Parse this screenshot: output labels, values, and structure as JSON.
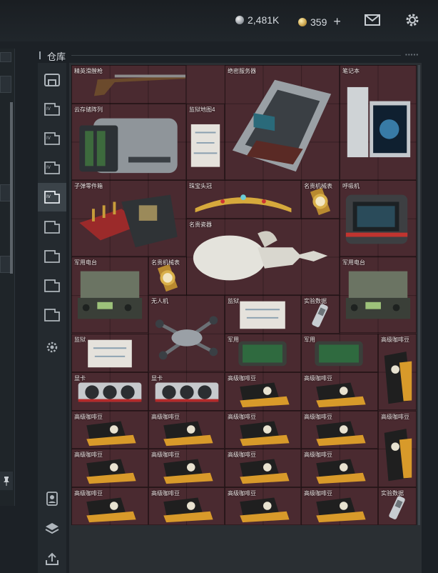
{
  "currency": {
    "silver": "2,481K",
    "gold": "359",
    "add_label": "+"
  },
  "top_icons": [
    "mail-icon",
    "gear-icon"
  ],
  "left_panel": {
    "pin_icon": "pin-icon"
  },
  "warehouse": {
    "title": "仓库"
  },
  "tabs": [
    {
      "icon": "home-icon",
      "active": false
    },
    {
      "icon": "storage-icon",
      "active": false
    },
    {
      "icon": "storage-icon",
      "active": false
    },
    {
      "icon": "storage-icon",
      "active": false
    },
    {
      "icon": "storage-icon",
      "active": true
    },
    {
      "icon": "storage-icon",
      "active": false
    },
    {
      "icon": "storage-icon",
      "active": false
    },
    {
      "icon": "storage-icon",
      "active": false
    },
    {
      "icon": "storage-icon",
      "active": false
    },
    {
      "icon": "gear-icon",
      "active": false
    },
    {
      "icon": "avatar-icon",
      "active": false
    },
    {
      "icon": "layers-icon",
      "active": false
    },
    {
      "icon": "upload-icon",
      "active": false
    }
  ],
  "items": [
    {
      "label": "精英滑膛枪",
      "icon": "musket-icon"
    },
    {
      "label": "绝密服务器",
      "icon": "server-icon"
    },
    {
      "label": "笔记本",
      "icon": "laptop-icon"
    },
    {
      "label": "云存储阵列",
      "icon": "storage-array-icon"
    },
    {
      "label": "监狱地图4",
      "icon": "map-icon"
    },
    {
      "label": "子弹零件箱",
      "icon": "ammo-crate-icon"
    },
    {
      "label": "珠宝头冠",
      "icon": "crown-icon"
    },
    {
      "label": "名贵机械表",
      "icon": "watch-icon"
    },
    {
      "label": "呼吸机",
      "icon": "ventilator-icon"
    },
    {
      "label": "名贵瓷器",
      "icon": "porcelain-icon"
    },
    {
      "label": "军用电台",
      "icon": "radio-icon"
    },
    {
      "label": "名贵机械表",
      "icon": "watch-icon"
    },
    {
      "label": "军用电台",
      "icon": "radio-icon"
    },
    {
      "label": "无人机",
      "icon": "drone-icon"
    },
    {
      "label": "监狱",
      "icon": "map-icon"
    },
    {
      "label": "实验数据",
      "icon": "data-icon"
    },
    {
      "label": "监狱",
      "icon": "map-icon"
    },
    {
      "label": "军用",
      "icon": "tablet-icon"
    },
    {
      "label": "军用",
      "icon": "tablet-icon"
    },
    {
      "label": "高级咖啡豆",
      "icon": "coffee-bag-icon"
    },
    {
      "label": "显卡",
      "icon": "gpu-icon"
    },
    {
      "label": "显卡",
      "icon": "gpu-icon"
    },
    {
      "label": "高级咖啡豆",
      "icon": "coffee-icon"
    },
    {
      "label": "高级咖啡豆",
      "icon": "coffee-icon"
    },
    {
      "label": "高级咖啡豆",
      "icon": "coffee-icon"
    },
    {
      "label": "高级咖啡豆",
      "icon": "coffee-icon"
    },
    {
      "label": "高级咖啡豆",
      "icon": "coffee-icon"
    },
    {
      "label": "高级咖啡豆",
      "icon": "coffee-icon"
    },
    {
      "label": "高级咖啡豆",
      "icon": "coffee-bag-icon"
    },
    {
      "label": "高级咖啡豆",
      "icon": "coffee-icon"
    },
    {
      "label": "高级咖啡豆",
      "icon": "coffee-icon"
    },
    {
      "label": "高级咖啡豆",
      "icon": "coffee-icon"
    },
    {
      "label": "高级咖啡豆",
      "icon": "coffee-icon"
    },
    {
      "label": "高级咖啡豆",
      "icon": "coffee-icon"
    },
    {
      "label": "高级咖啡豆",
      "icon": "coffee-icon"
    },
    {
      "label": "高级咖啡豆",
      "icon": "coffee-icon"
    },
    {
      "label": "高级咖啡豆",
      "icon": "coffee-icon"
    },
    {
      "label": "实验数据",
      "icon": "data-icon"
    }
  ]
}
